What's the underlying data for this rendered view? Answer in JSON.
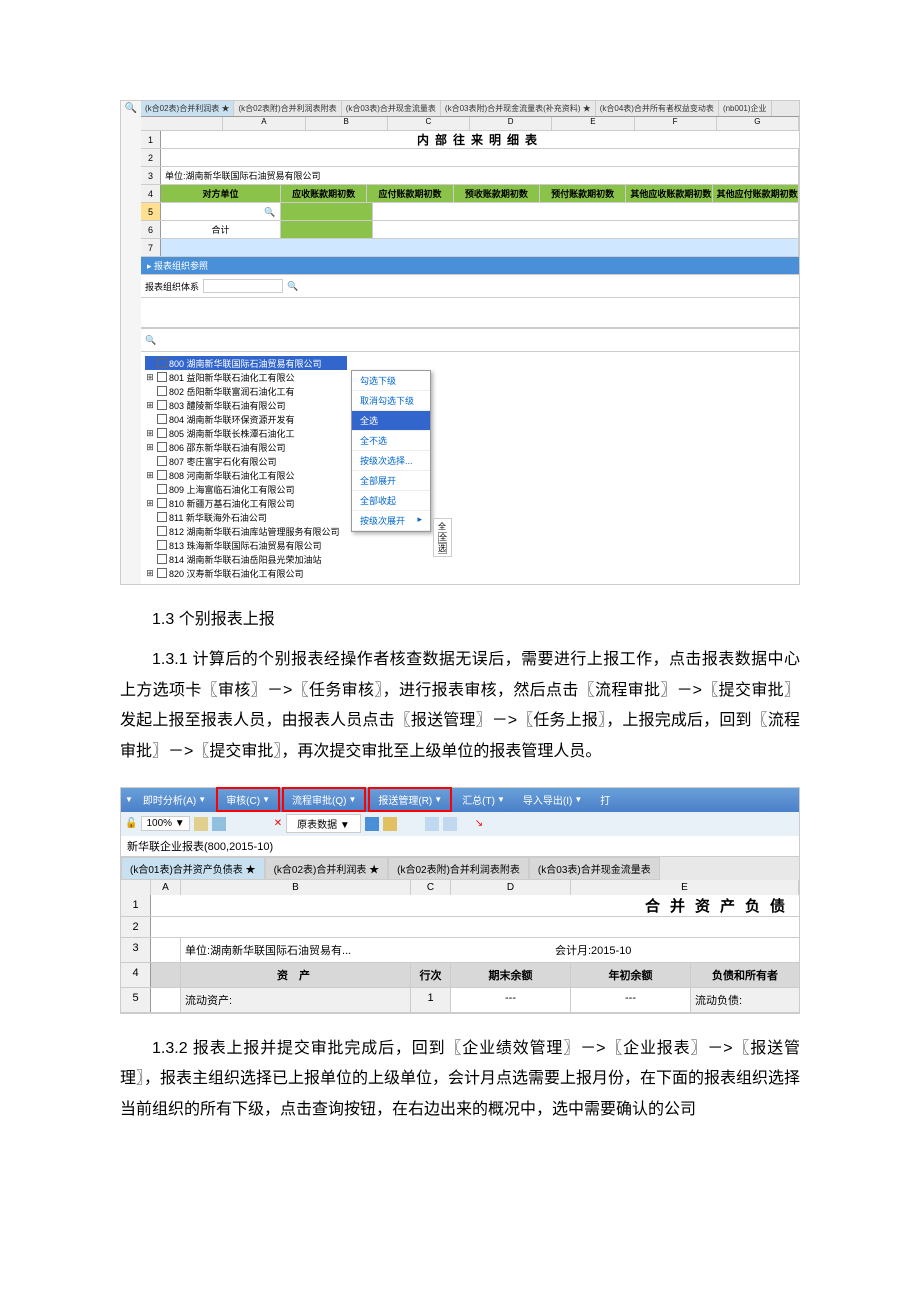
{
  "screenshot1": {
    "tabs": [
      "(k合02表)合并利润表 ★",
      "(k合02表附)合并利润表附表",
      "(k合03表)合并现金流量表",
      "(k合03表附)合并现金流量表(补充资料) ★",
      "(k合04表)合并所有者权益变动表",
      "(nb001)企业"
    ],
    "cols": [
      "A",
      "B",
      "C",
      "D",
      "E",
      "F",
      "G"
    ],
    "title": "内部往来明细表",
    "unit_label": "单位:湖南新华联国际石油贸易有限公司",
    "headers": [
      "对方单位",
      "应收账款期初数",
      "应付账款期初数",
      "预收账款期初数",
      "预付账款期初数",
      "其他应收账款期初数",
      "其他应付账款期初数"
    ],
    "total_label": "合计",
    "panel_title": "报表组织参照",
    "org_label": "报表组织体系",
    "tree": [
      "800 湖南新华联国际石油贸易有限公司",
      "801 益阳新华联石油化工有限公",
      "802 岳阳新华联富润石油化工有",
      "803 醴陵新华联石油有限公司",
      "804 湖南新华联环保资源开发有",
      "805 湖南新华联长株潭石油化工",
      "806 邵东新华联石油有限公司",
      "807 枣庄富宇石化有限公司",
      "808 河南新华联石油化工有限公",
      "809 上海富临石油化工有限公司",
      "810 新疆万基石油化工有限公司",
      "811 新华联海外石油公司",
      "812 湖南新华联石油库站管理服务有限公司",
      "813 珠海新华联国际石油贸易有限公司",
      "814 湖南新华联石油岳阳县光荣加油站",
      "820 汉寿新华联石油化工有限公司"
    ],
    "tree_expand": [
      true,
      true,
      false,
      true,
      false,
      true,
      true,
      false,
      true,
      false,
      true,
      false,
      false,
      false,
      false,
      true
    ],
    "context_menu": [
      "勾选下级",
      "取消勾选下级",
      "全选",
      "全不选",
      "按级次选择...",
      "全部展开",
      "全部收起",
      "按级次展开"
    ],
    "submenu_hint": "全选"
  },
  "text_blocks": {
    "h1": "1.3 个别报表上报",
    "p1": "1.3.1 计算后的个别报表经操作者核查数据无误后，需要进行上报工作，点击报表数据中心上方选项卡〖审核〗－>〖任务审核〗，进行报表审核，然后点击〖流程审批〗－>〖提交审批〗发起上报至报表人员，由报表人员点击〖报送管理〗－>〖任务上报〗，上报完成后，回到〖流程审批〗－>〖提交审批〗，再次提交审批至上级单位的报表管理人员。",
    "p2": "1.3.2 报表上报并提交审批完成后，回到〖企业绩效管理〗－>〖企业报表〗－>〖报送管理〗，报表主组织选择已上报单位的上级单位，会计月点选需要上报月份，在下面的报表组织选择当前组织的所有下级，点击查询按钮，在右边出来的概况中，选中需要确认的公司"
  },
  "screenshot2": {
    "toolbar": {
      "analysis": "即时分析(A)",
      "audit": "审核(C)",
      "process": "流程审批(Q)",
      "report": "报送管理(R)",
      "summary": "汇总(T)",
      "import": "导入导出(I)",
      "print": "打"
    },
    "zoom": "100%",
    "data_label": "原表数据",
    "crumb": "新华联企业报表(800,2015-10)",
    "tabs": [
      "(k合01表)合并资产负债表 ★",
      "(k合02表)合并利润表 ★",
      "(k合02表附)合并利润表附表",
      "(k合03表)合并现金流量表"
    ],
    "cols": [
      "A",
      "B",
      "C",
      "D",
      "E"
    ],
    "title": "合并资产负债",
    "unit": "单位:湖南新华联国际石油贸易有...",
    "month": "会计月:2015-10",
    "hdr": [
      "资 产",
      "行次",
      "期末余额",
      "年初余额",
      "负债和所有者"
    ],
    "row5": [
      "流动资产:",
      "1",
      "---",
      "---",
      "流动负债:"
    ]
  }
}
